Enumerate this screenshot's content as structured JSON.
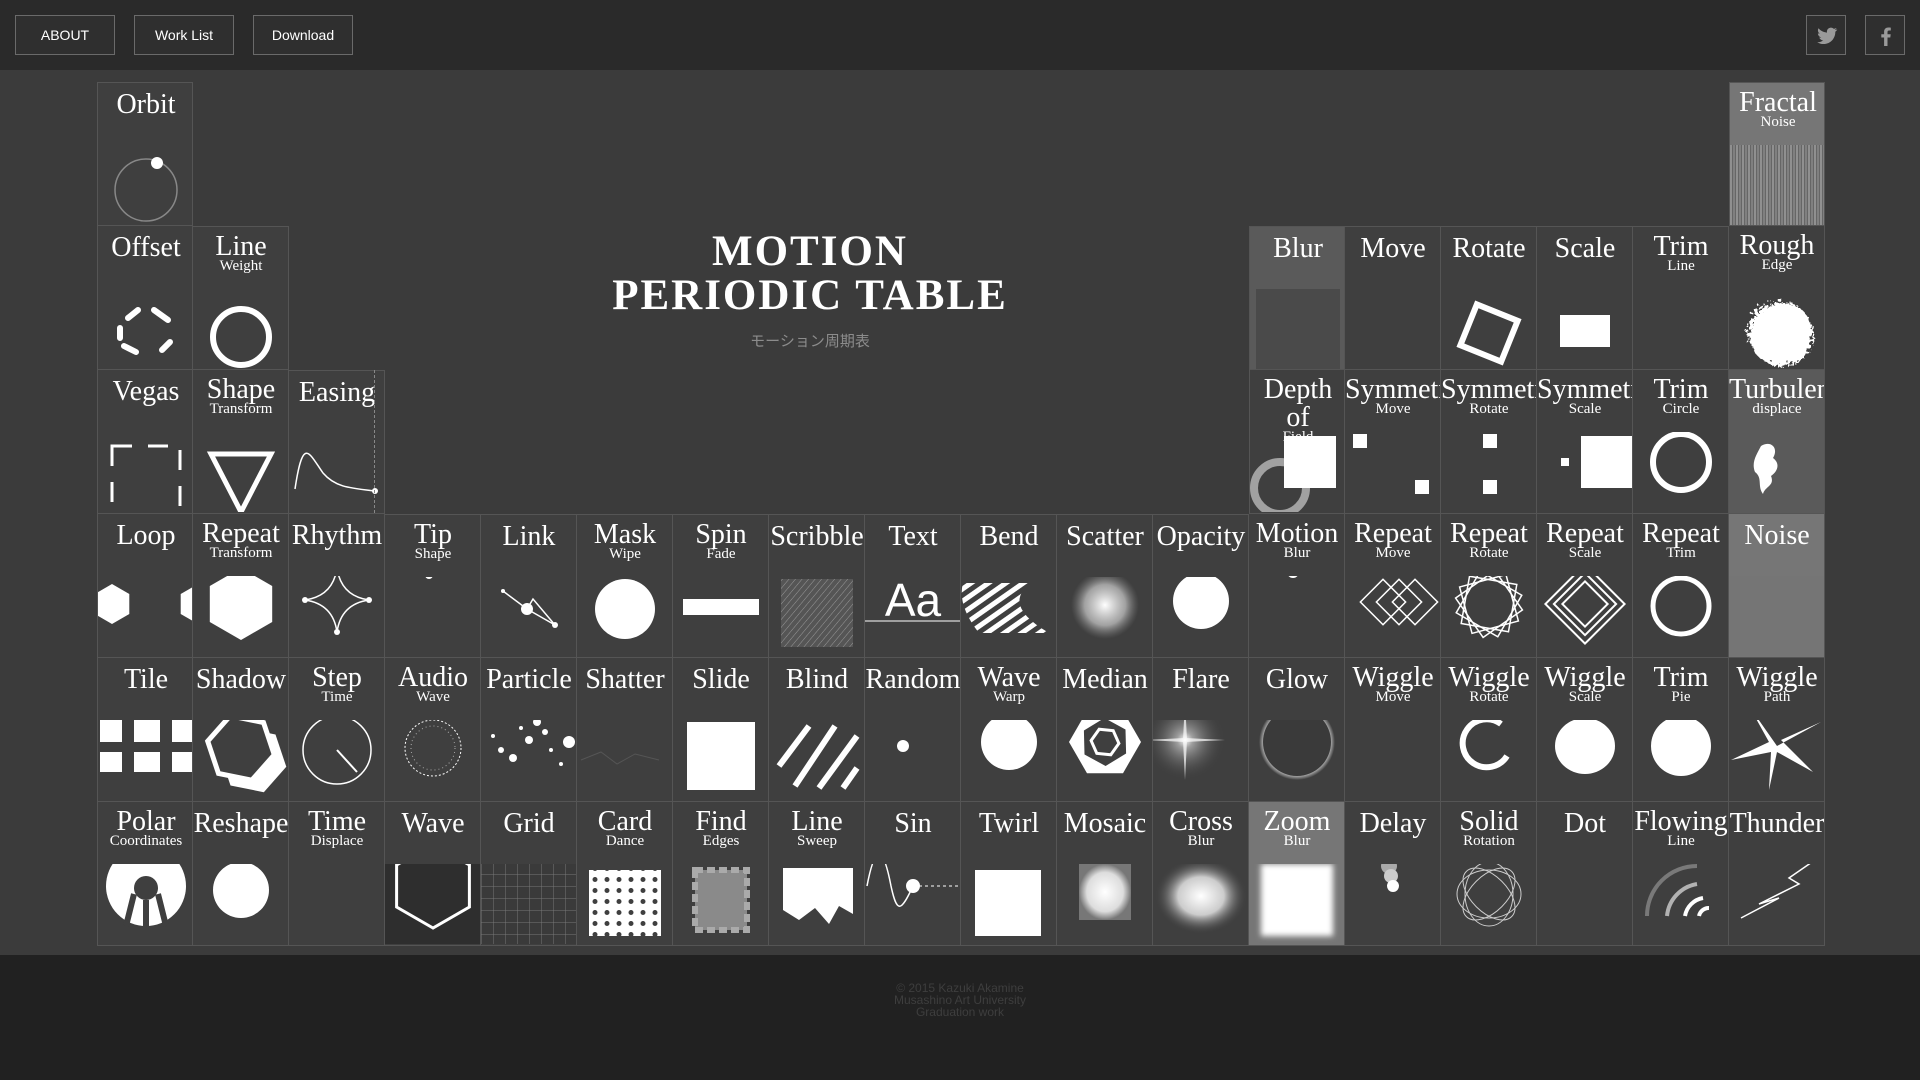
{
  "nav": {
    "about": "ABOUT",
    "worklist": "Work List",
    "download": "Download"
  },
  "social": {
    "twitter": "twitter-icon",
    "facebook": "facebook-icon"
  },
  "title": {
    "line1": "MOTION",
    "line2": "PERIODIC TABLE",
    "sub": "モーション周期表"
  },
  "footer": {
    "line1": "© 2015 Kazuki Akamine",
    "line2": "Musashino Art University",
    "line3": "Graduation work"
  },
  "elements": [
    {
      "id": "orbit",
      "r1": "Orbit"
    },
    {
      "id": "fractal-noise",
      "r1": "Fractal",
      "r2": "Noise"
    },
    {
      "id": "offset",
      "r1": "Offset"
    },
    {
      "id": "line-weight",
      "r1": "Line",
      "r2": "Weight"
    },
    {
      "id": "blur",
      "r1": "Blur"
    },
    {
      "id": "move",
      "r1": "Move"
    },
    {
      "id": "rotate",
      "r1": "Rotate"
    },
    {
      "id": "scale",
      "r1": "Scale"
    },
    {
      "id": "trim-line",
      "r1": "Trim",
      "r2": "Line"
    },
    {
      "id": "rough-edge",
      "r1": "Rough",
      "r2": "Edge"
    },
    {
      "id": "vegas",
      "r1": "Vegas"
    },
    {
      "id": "shape-transform",
      "r1": "Shape",
      "r2": "Transform"
    },
    {
      "id": "easing",
      "r1": "Easing"
    },
    {
      "id": "depth-of-field",
      "r1": "Depth of",
      "r2": "Field"
    },
    {
      "id": "symmetric-move",
      "r1": "Symmetric",
      "r2": "Move"
    },
    {
      "id": "symmetric-rotate",
      "r1": "Symmetric",
      "r2": "Rotate"
    },
    {
      "id": "symmetric-scale",
      "r1": "Symmetric",
      "r2": "Scale"
    },
    {
      "id": "trim-circle",
      "r1": "Trim",
      "r2": "Circle"
    },
    {
      "id": "turbulent-displace",
      "r1": "Turbulent",
      "r2": "displace"
    },
    {
      "id": "loop",
      "r1": "Loop"
    },
    {
      "id": "repeat-transform",
      "r1": "Repeat",
      "r2": "Transform"
    },
    {
      "id": "rhythm",
      "r1": "Rhythm"
    },
    {
      "id": "tip-shape",
      "r1": "Tip",
      "r2": "Shape"
    },
    {
      "id": "link",
      "r1": "Link"
    },
    {
      "id": "mask-wipe",
      "r1": "Mask",
      "r2": "Wipe"
    },
    {
      "id": "spin-fade",
      "r1": "Spin",
      "r2": "Fade"
    },
    {
      "id": "scribble",
      "r1": "Scribble"
    },
    {
      "id": "text",
      "r1": "Text",
      "glyph": "Aa"
    },
    {
      "id": "bend",
      "r1": "Bend"
    },
    {
      "id": "scatter",
      "r1": "Scatter"
    },
    {
      "id": "opacity",
      "r1": "Opacity"
    },
    {
      "id": "motion-blur",
      "r1": "Motion",
      "r2": "Blur"
    },
    {
      "id": "repeat-move",
      "r1": "Repeat",
      "r2": "Move"
    },
    {
      "id": "repeat-rotate",
      "r1": "Repeat",
      "r2": "Rotate"
    },
    {
      "id": "repeat-scale",
      "r1": "Repeat",
      "r2": "Scale"
    },
    {
      "id": "repeat-trim",
      "r1": "Repeat",
      "r2": "Trim"
    },
    {
      "id": "noise",
      "r1": "Noise"
    },
    {
      "id": "tile",
      "r1": "Tile"
    },
    {
      "id": "shadow",
      "r1": "Shadow"
    },
    {
      "id": "step-time",
      "r1": "Step",
      "r2": "Time"
    },
    {
      "id": "audio-wave",
      "r1": "Audio",
      "r2": "Wave"
    },
    {
      "id": "particle",
      "r1": "Particle"
    },
    {
      "id": "shatter",
      "r1": "Shatter"
    },
    {
      "id": "slide",
      "r1": "Slide"
    },
    {
      "id": "blind",
      "r1": "Blind"
    },
    {
      "id": "random",
      "r1": "Random"
    },
    {
      "id": "wave-warp",
      "r1": "Wave",
      "r2": "Warp"
    },
    {
      "id": "median",
      "r1": "Median"
    },
    {
      "id": "flare",
      "r1": "Flare"
    },
    {
      "id": "glow",
      "r1": "Glow"
    },
    {
      "id": "wiggle-move",
      "r1": "Wiggle",
      "r2": "Move"
    },
    {
      "id": "wiggle-rotate",
      "r1": "Wiggle",
      "r2": "Rotate"
    },
    {
      "id": "wiggle-scale",
      "r1": "Wiggle",
      "r2": "Scale"
    },
    {
      "id": "trim-pie",
      "r1": "Trim",
      "r2": "Pie"
    },
    {
      "id": "wiggle-path",
      "r1": "Wiggle",
      "r2": "Path"
    },
    {
      "id": "polar-coordinates",
      "r1": "Polar",
      "r2": "Coordinates"
    },
    {
      "id": "reshape",
      "r1": "Reshape"
    },
    {
      "id": "time-displace",
      "r1": "Time",
      "r2": "Displace"
    },
    {
      "id": "wave",
      "r1": "Wave"
    },
    {
      "id": "grid",
      "r1": "Grid"
    },
    {
      "id": "card-dance",
      "r1": "Card",
      "r2": "Dance"
    },
    {
      "id": "find-edges",
      "r1": "Find",
      "r2": "Edges"
    },
    {
      "id": "line-sweep",
      "r1": "Line",
      "r2": "Sweep"
    },
    {
      "id": "sin",
      "r1": "Sin"
    },
    {
      "id": "twirl",
      "r1": "Twirl"
    },
    {
      "id": "mosaic",
      "r1": "Mosaic"
    },
    {
      "id": "cross-blur",
      "r1": "Cross",
      "r2": "Blur"
    },
    {
      "id": "zoom-blur",
      "r1": "Zoom",
      "r2": "Blur"
    },
    {
      "id": "delay",
      "r1": "Delay"
    },
    {
      "id": "solid-rotation",
      "r1": "Solid",
      "r2": "Rotation"
    },
    {
      "id": "dot",
      "r1": "Dot"
    },
    {
      "id": "flowing-line",
      "r1": "Flowing",
      "r2": "Line"
    },
    {
      "id": "thunder",
      "r1": "Thunder"
    }
  ]
}
